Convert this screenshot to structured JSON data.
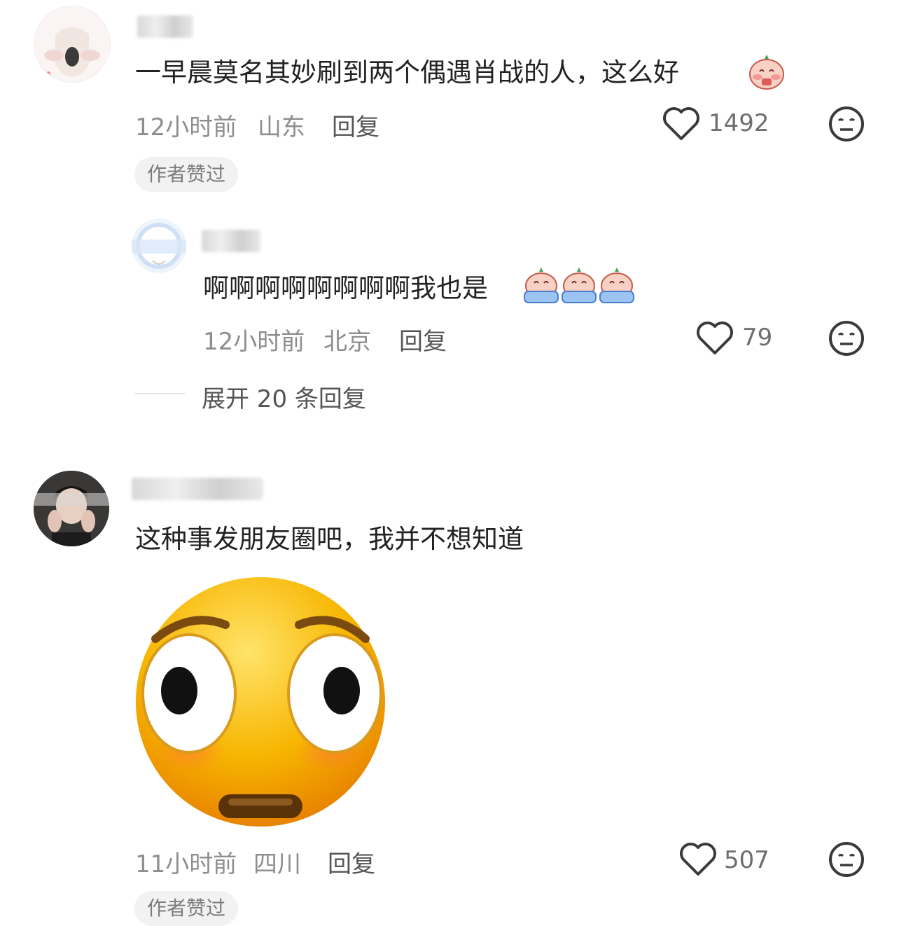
{
  "comments": [
    {
      "text": "一早晨莫名其妙刷到两个偶遇肖战的人，这么好",
      "time": "12小时前",
      "location": "山东",
      "reply_label": "回复",
      "likes": "1492",
      "badge": "作者赞过",
      "reply": {
        "text": "啊啊啊啊啊啊啊啊我也是",
        "time": "12小时前",
        "location": "北京",
        "reply_label": "回复",
        "likes": "79"
      },
      "expand_label": "展开 20 条回复"
    },
    {
      "text": "这种事发朋友圈吧，我并不想知道",
      "time": "11小时前",
      "location": "四川",
      "reply_label": "回复",
      "likes": "507",
      "badge": "作者赞过"
    }
  ],
  "icons": {
    "like": "heart-outline-icon",
    "dislike": "meh-face-icon",
    "sticker": "shocked-face-emoji"
  },
  "colors": {
    "text": "#222222",
    "meta": "#8e8e8e",
    "badge_bg": "#f2f2f2",
    "emoji_yellow": "#f7b500"
  }
}
